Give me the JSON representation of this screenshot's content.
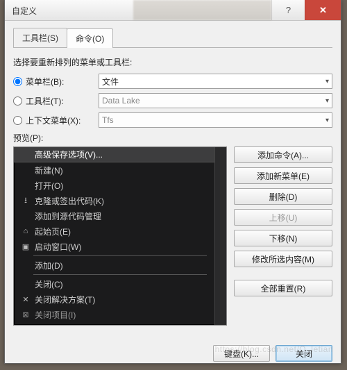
{
  "window": {
    "title": "自定义"
  },
  "tabs": {
    "toolbar": "工具栏(S)",
    "commands": "命令(O)"
  },
  "instruction": "选择要重新排列的菜单或工具栏:",
  "radios": {
    "menubar": {
      "label": "菜单栏(B):",
      "value": "文件"
    },
    "toolbar": {
      "label": "工具栏(T):",
      "value": "Data Lake"
    },
    "context": {
      "label": "上下文菜单(X):",
      "value": "Tfs"
    }
  },
  "preview_label": "预览(P):",
  "list": {
    "selected": "高级保存选项(V)...",
    "items": [
      {
        "label": "新建(N)",
        "sub": true
      },
      {
        "label": "打开(O)",
        "sub": true
      },
      {
        "icon": "download",
        "label": "克隆或签出代码(K)"
      },
      {
        "label": "添加到源代码管理"
      },
      {
        "icon": "home",
        "label": "起始页(E)"
      },
      {
        "icon": "window",
        "label": "启动窗口(W)"
      },
      {
        "divider": true
      },
      {
        "label": "添加(D)",
        "sub": true
      },
      {
        "divider": true
      },
      {
        "label": "关闭(C)"
      },
      {
        "icon": "x",
        "label": "关闭解决方案(T)"
      },
      {
        "icon": "xs",
        "label": "关闭项目(I)"
      }
    ]
  },
  "buttons": {
    "add_cmd": "添加命令(A)...",
    "add_menu": "添加新菜单(E)",
    "delete": "删除(D)",
    "move_up": "上移(U)",
    "move_down": "下移(N)",
    "modify": "修改所选内容(M)",
    "reset": "全部重置(R)",
    "keyboard": "键盘(K)...",
    "close": "关闭"
  }
}
